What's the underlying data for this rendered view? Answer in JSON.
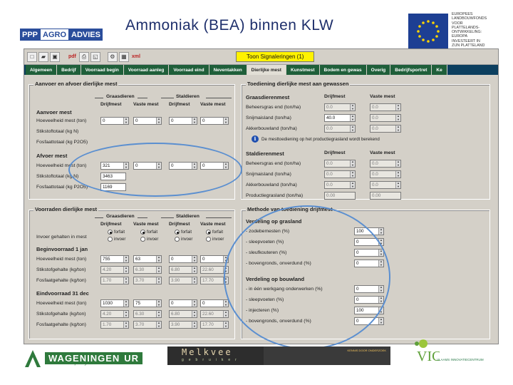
{
  "slide": {
    "title": "Ammoniak (BEA) binnen KLW",
    "logo_parts": [
      "PPP",
      "AGRO",
      "ADVIES"
    ],
    "eu_text": [
      "EUROPEES",
      "LANDBOUWFONDS",
      "VOOR",
      "PLATTELANDS-",
      "ONTWIKKELING:",
      "EUROPA",
      "INVESTEERT IN",
      "ZIJN PLATTELAND"
    ],
    "footer": {
      "wur_name": "WAGENINGEN",
      "wur_suffix": "UR",
      "wur_tagline": "For quality of life",
      "melkvee_word": "Melkvee",
      "melkvee_sub": "gebruiker",
      "melkvee_bar_text": "KENNIS DOOR ONDERZOEK",
      "vic_letters": "VIC",
      "vic_sub": "VLAAMS INNOVATIECENTRUM"
    }
  },
  "toolbar": {
    "buttons": [
      "new",
      "open",
      "save",
      "pdf",
      "print",
      "preview",
      "settings",
      "table",
      "xml"
    ],
    "pdf_label": "pdf",
    "xml_label": "xml",
    "signal_button": "Toon Signaleringen (1)"
  },
  "tabs": [
    "Algemeen",
    "Bedrijf",
    "Voorraad begin",
    "Voorraad aanleg",
    "Voorraad eind",
    "Neventakken",
    "Dierlijke mest",
    "Kunstmest",
    "Bodem en gewas",
    "Overig",
    "Bedrijfsportret",
    "Ke"
  ],
  "active_tab": 6,
  "aanvoer": {
    "title": "Aanvoer en afvoer dierlijke mest",
    "grasdieren": "Graasdieren",
    "staldieren": "Staldieren",
    "col_drijfmest": "Drijfmest",
    "col_vaste_mest": "Vaste mest",
    "aanvoer_heading": "Aanvoer mest",
    "afvoer_heading": "Afvoer mest",
    "labels": {
      "hoeveelheid": "Hoeveelheid mest (ton)",
      "stikstof": "Stikstoftotaal (kg N)",
      "fosfaat": "Fosfaattotaal (kg P2O5)"
    },
    "aanvoer_values": [
      "0",
      "0",
      "0",
      "0"
    ],
    "afvoer_values": {
      "hoeveelheid": [
        "321",
        "0",
        "0",
        "0"
      ],
      "stikstof": "3463",
      "fosfaat": "1169"
    }
  },
  "toediening_gewas": {
    "title": "Toediening dierlijke mest aan gewassen",
    "grasdieren_heading": "Graasdierenmest",
    "staldieren_heading": "Staldierenmest",
    "col_drijfmest": "Drijfmest",
    "col_vaste_mest": "Vaste mest",
    "rows_graas": [
      {
        "label": "Beheersgras end (ton/ha)",
        "d": "0.0",
        "v": "0.0"
      },
      {
        "label": "Snijmaisland (ton/ha)",
        "d": "40.0",
        "v": "0.0"
      },
      {
        "label": "Akkerbouwland (ton/ha)",
        "d": "0.0",
        "v": "0.0"
      }
    ],
    "info_text": "De mesttoediening op het productiegrasland wordt berekend",
    "rows_stal": [
      {
        "label": "Beheersgras end (ton/ha)",
        "d": "0.0",
        "v": "0.0"
      },
      {
        "label": "Snijmaisland (ton/ha)",
        "d": "0.0",
        "v": "0.0"
      },
      {
        "label": "Akkerbouwland (ton/ha)",
        "d": "0.0",
        "v": "0.0"
      },
      {
        "label": "Productiegrasland (ton/ha)",
        "d": "0.00",
        "v": "0.00"
      }
    ]
  },
  "voorraden": {
    "title": "Voorraden dierlijke mest",
    "grasdieren": "Graasdieren",
    "staldieren": "Staldieren",
    "col_drijfmest": "Drijfmest",
    "col_vaste_mest": "Vaste mest",
    "invoer_label": "Invoer gehalten in mest",
    "radio_forfait": "forfait",
    "radio_invoer": "invoer",
    "begin_heading": "Beginvoorraad 1 jan",
    "eind_heading": "Eindvoorraad 31 dec",
    "row_labels": [
      "Hoeveelheid mest (ton)",
      "Stikstofgehalte (kg/ton)",
      "Fosfaatgehalte (kg/ton)"
    ],
    "begin": [
      [
        "755",
        "63",
        "0",
        "0"
      ],
      [
        "4.20",
        "6.30",
        "6.80",
        "22.60"
      ],
      [
        "1.70",
        "3.70",
        "3.90",
        "17.70"
      ]
    ],
    "eind": [
      [
        "1030",
        "75",
        "0",
        "0"
      ],
      [
        "4.20",
        "6.30",
        "6.80",
        "22.60"
      ],
      [
        "1.70",
        "3.70",
        "3.90",
        "17.70"
      ]
    ]
  },
  "methode": {
    "title": "Methode van toediening drijfmest",
    "grasland_heading": "Verdeling op grasland",
    "grasland_rows": [
      {
        "label": "- zodebemesten (%)",
        "value": "100"
      },
      {
        "label": "- sleepvoeten (%)",
        "value": "0"
      },
      {
        "label": "- sleufkouteren (%)",
        "value": "0"
      },
      {
        "label": "- bovengronds, onverdund (%)",
        "value": "0"
      }
    ],
    "bouwland_heading": "Verdeling op bouwland",
    "bouwland_rows": [
      {
        "label": "- in één werkgang onderwerken (%)",
        "value": "0"
      },
      {
        "label": "- sleepvoeten (%)",
        "value": "0"
      },
      {
        "label": "- injecteren (%)",
        "value": "100"
      },
      {
        "label": "- bovengronds, onverdund (%)",
        "value": "0"
      }
    ]
  }
}
